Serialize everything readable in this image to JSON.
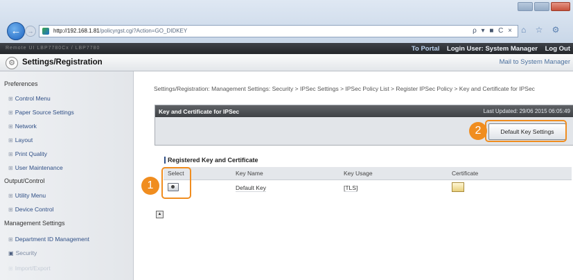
{
  "browser": {
    "url_host": "http://192.168.1.81",
    "url_path": "/policyrgst.cgi?Action=GO_DIDKEY",
    "address_controls": "ρ ▾ ■ C ×",
    "toolbar_glyphs": "⌂ ☆ ⚙"
  },
  "topbar": {
    "printer_info": "Remote UI    LBP7780Cx / LBP7780",
    "portal_link": "To Portal",
    "login_user": "Login User: System Manager",
    "logout_link": "Log Out"
  },
  "header": {
    "title": "Settings/Registration",
    "mail_link": "Mail to System Manager"
  },
  "sidebar": {
    "sections": [
      {
        "label": "Preferences"
      },
      {
        "label": "Output/Control"
      },
      {
        "label": "Management Settings"
      }
    ],
    "items": [
      {
        "label": "Control Menu"
      },
      {
        "label": "Paper Source Settings"
      },
      {
        "label": "Network"
      },
      {
        "label": "Layout"
      },
      {
        "label": "Print Quality"
      },
      {
        "label": "User Maintenance"
      },
      {
        "label": "Utility Menu"
      },
      {
        "label": "Device Control"
      },
      {
        "label": "Department ID Management"
      },
      {
        "label": "Security"
      },
      {
        "label": "Import/Export"
      }
    ]
  },
  "breadcrumb": "Settings/Registration: Management Settings: Security > IPSec Settings > IPSec Policy List > Register IPSec Policy > Key and Certificate for IPSec",
  "panel": {
    "title": "Key and Certificate for IPSec",
    "last_updated": "Last Updated: 29/06 2015 06:05:49",
    "default_key_button": "Default Key Settings"
  },
  "registered": {
    "title": "Registered Key and Certificate",
    "columns": [
      "Select",
      "Key Name",
      "Key Usage",
      "Certificate"
    ],
    "rows": [
      {
        "key_name": "Default Key",
        "key_usage": "[TLS]"
      }
    ]
  },
  "callouts": {
    "one": "1",
    "two": "2"
  },
  "colors": {
    "callout": "#f08d1f",
    "link": "#2f4f86"
  }
}
